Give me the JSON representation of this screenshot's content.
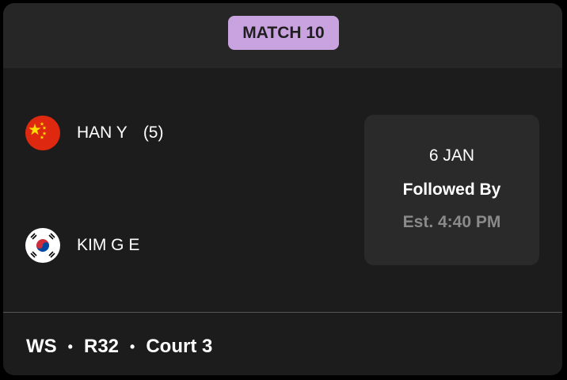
{
  "match": {
    "label": "MATCH 10"
  },
  "players": [
    {
      "name": "HAN Y",
      "seed": "(5)",
      "flag_icon": "china-flag-icon"
    },
    {
      "name": "KIM G E",
      "seed": "",
      "flag_icon": "south-korea-flag-icon"
    }
  ],
  "schedule": {
    "date": "6 JAN",
    "followed_by": "Followed By",
    "est_time": "Est. 4:40 PM"
  },
  "footer": {
    "event": "WS",
    "separator": "•",
    "round": "R32",
    "court": "Court 3"
  },
  "colors": {
    "badge_bg": "#c9a2e0",
    "card_bg": "#1c1c1c",
    "header_bg": "#262626",
    "info_bg": "#2a2a2a",
    "muted_text": "#8a8a8a"
  }
}
